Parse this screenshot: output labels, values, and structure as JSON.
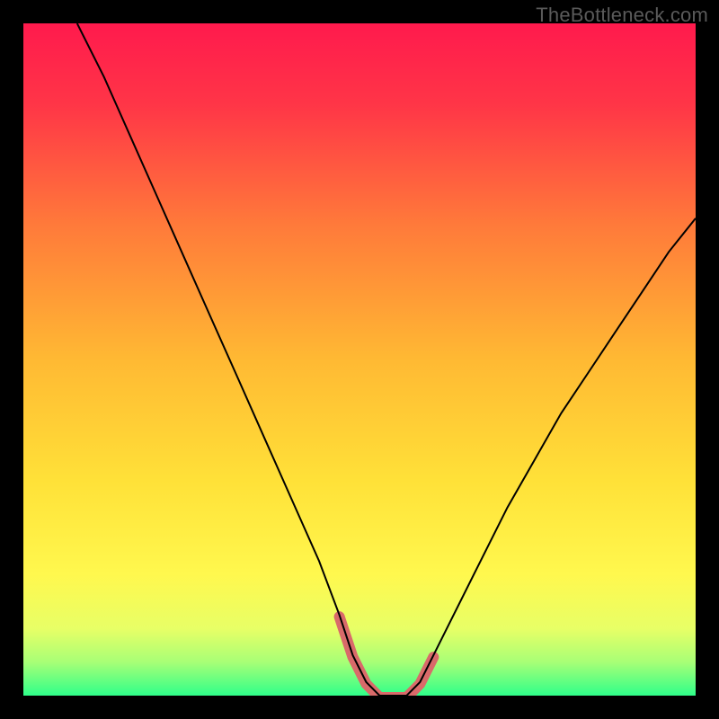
{
  "watermark": "TheBottleneck.com",
  "chart_data": {
    "type": "line",
    "title": "",
    "xlabel": "",
    "ylabel": "",
    "xlim": [
      0,
      100
    ],
    "ylim": [
      0,
      100
    ],
    "grid": false,
    "series": [
      {
        "name": "curve",
        "x": [
          8,
          12,
          16,
          20,
          24,
          28,
          32,
          36,
          40,
          44,
          47,
          49,
          51,
          53,
          55,
          57,
          59,
          61,
          64,
          68,
          72,
          76,
          80,
          84,
          88,
          92,
          96,
          100
        ],
        "y": [
          100,
          92,
          83,
          74,
          65,
          56,
          47,
          38,
          29,
          20,
          12,
          6,
          2,
          0,
          0,
          0,
          2,
          6,
          12,
          20,
          28,
          35,
          42,
          48,
          54,
          60,
          66,
          71
        ]
      }
    ],
    "flat_bottom_range_x": [
      47,
      61
    ],
    "background_gradient": {
      "stops": [
        {
          "pos": 0.0,
          "color": "#ff1a4d"
        },
        {
          "pos": 0.12,
          "color": "#ff3547"
        },
        {
          "pos": 0.3,
          "color": "#ff7a3a"
        },
        {
          "pos": 0.5,
          "color": "#ffb933"
        },
        {
          "pos": 0.68,
          "color": "#ffe138"
        },
        {
          "pos": 0.82,
          "color": "#fff84e"
        },
        {
          "pos": 0.9,
          "color": "#e8ff66"
        },
        {
          "pos": 0.95,
          "color": "#a8ff76"
        },
        {
          "pos": 1.0,
          "color": "#2fff8a"
        }
      ]
    },
    "colors": {
      "curve": "#000000",
      "bottom_marker": "#d96a6a"
    }
  }
}
